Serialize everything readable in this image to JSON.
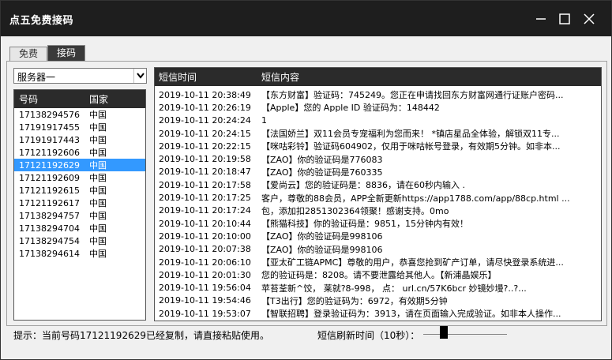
{
  "window": {
    "title": "点五免费接码"
  },
  "tabs": [
    {
      "label": "免费",
      "active": false
    },
    {
      "label": "接码",
      "active": true
    }
  ],
  "server_select": {
    "value": "服务器一"
  },
  "number_list": {
    "headers": {
      "number": "号码",
      "country": "国家"
    },
    "selected_index": 4,
    "rows": [
      {
        "number": "17138294576",
        "country": "中国"
      },
      {
        "number": "17191917455",
        "country": "中国"
      },
      {
        "number": "17191917443",
        "country": "中国"
      },
      {
        "number": "17121192606",
        "country": "中国"
      },
      {
        "number": "17121192629",
        "country": "中国"
      },
      {
        "number": "17121192609",
        "country": "中国"
      },
      {
        "number": "17121192615",
        "country": "中国"
      },
      {
        "number": "17121192617",
        "country": "中国"
      },
      {
        "number": "17138294757",
        "country": "中国"
      },
      {
        "number": "17138294704",
        "country": "中国"
      },
      {
        "number": "17138294754",
        "country": "中国"
      },
      {
        "number": "17138294614",
        "country": "中国"
      }
    ]
  },
  "message_list": {
    "headers": {
      "time": "短信时间",
      "content": "短信内容"
    },
    "rows": [
      {
        "time": "2019-10-11 20:38:49",
        "content": "【东方财富】验证码：745249。您正在申请找回东方财富网通行证账户密码..."
      },
      {
        "time": "2019-10-11 20:26:19",
        "content": "【Apple】您的 Apple ID 验证码为：148442"
      },
      {
        "time": "2019-10-11 20:24:24",
        "content": "1"
      },
      {
        "time": "2019-10-11 20:24:15",
        "content": "【法国娇兰】双11会员专宠福利为您而来！ *镇店星品全体验，解锁双11专..."
      },
      {
        "time": "2019-10-11 20:22:15",
        "content": "【咪咕彩铃】验证码604902，仅用于咪咕帐号登录，有效期5分钟。如非本..."
      },
      {
        "time": "2019-10-11 20:19:58",
        "content": "【ZAO】你的验证码是776083"
      },
      {
        "time": "2019-10-11 20:18:47",
        "content": "【ZAO】你的验证码是760335"
      },
      {
        "time": "2019-10-11 20:17:58",
        "content": "【爱尚云】您的验证码是：8836，请在60秒内输入 ."
      },
      {
        "time": "2019-10-11 20:17:25",
        "content": "客户，尊敬的88会员，APP全新更新https://app1788.com/app/88cp.html ..."
      },
      {
        "time": "2019-10-11 20:17:24",
        "content": "包，添加扣2851302364领聚！感谢支持。0mo"
      },
      {
        "time": "2019-10-11 20:10:44",
        "content": "【熊猫科技】你的验证码是：9851，15分钟内有效！"
      },
      {
        "time": "2019-10-11 20:10:00",
        "content": "【ZAO】你的验证码是998106"
      },
      {
        "time": "2019-10-11 20:07:38",
        "content": "【ZAO】你的验证码是998106"
      },
      {
        "time": "2019-10-11 20:06:10",
        "content": "【亚太矿工链APMC】尊敬的用户，恭喜您抢到矿产订单，请尽快登录系统进..."
      },
      {
        "time": "2019-10-11 20:01:30",
        "content": "您的验证码是：8208。请不要泄露给其他人。【新浦晶娱乐】"
      },
      {
        "time": "2019-10-11 19:56:04",
        "content": "苹苔荃新^饺，  莱就?8-998，  点：   url.cn/57K6bcr    妙镜妙墁?..?..."
      },
      {
        "time": "2019-10-11 19:54:46",
        "content": "【T3出行】您的验证码为：6972，有效期5分钟"
      },
      {
        "time": "2019-10-11 19:53:07",
        "content": "【智联招聘】登录验证码为：3913，请在页面输入完成验证。如非本人操作..."
      }
    ]
  },
  "status": {
    "tip": "提示：当前号码17121192629已经复制，请直接粘贴使用。",
    "refresh_label": "短信刷新时间（10秒）："
  },
  "refresh_slider": {
    "value_fraction": 0.22
  }
}
